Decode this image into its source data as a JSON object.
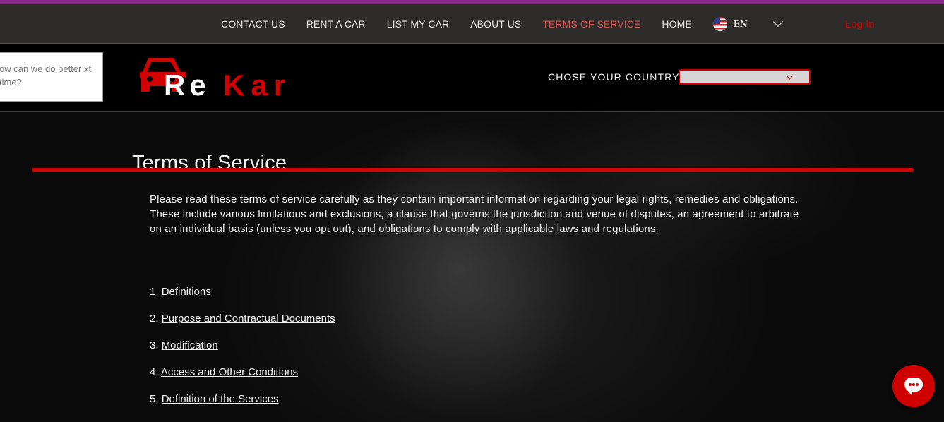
{
  "nav": {
    "items": [
      "CONTACT US",
      "RENT A CAR",
      "LIST MY CAR",
      "ABOUT US",
      "TERMS OF SERVICE",
      "HOME"
    ],
    "active_index": 4,
    "language": "EN",
    "login": "Log In"
  },
  "feedback": {
    "text": "ow can we do better xt time?"
  },
  "logo": {
    "text_white": "Re",
    "text_red": "Kar",
    "brand_red": "#d20000"
  },
  "country": {
    "label": "CHOSE YOUR COUNTRY",
    "selected": ""
  },
  "page": {
    "title": "Terms of Service",
    "intro": "Please read these terms of service carefully as they contain important information regarding your legal rights, remedies and obligations. These include various limitations and exclusions, a clause that governs the jurisdiction and venue of disputes, an agreement to arbitrate on an individual basis (unless you opt out), and obligations to comply with applicable laws and regulations.",
    "toc": [
      {
        "num": "1.",
        "label": "Definitions"
      },
      {
        "num": "2.",
        "label": "Purpose and Contractual Documents"
      },
      {
        "num": "3.",
        "label": "Modification"
      },
      {
        "num": "4.",
        "label": "Access and Other Conditions"
      },
      {
        "num": "5.",
        "label": "Definition of the Services"
      }
    ]
  },
  "icons": {
    "flag": "us-flag-icon",
    "language_chevron": "chevron-down-icon",
    "chat": "chat-icon"
  }
}
